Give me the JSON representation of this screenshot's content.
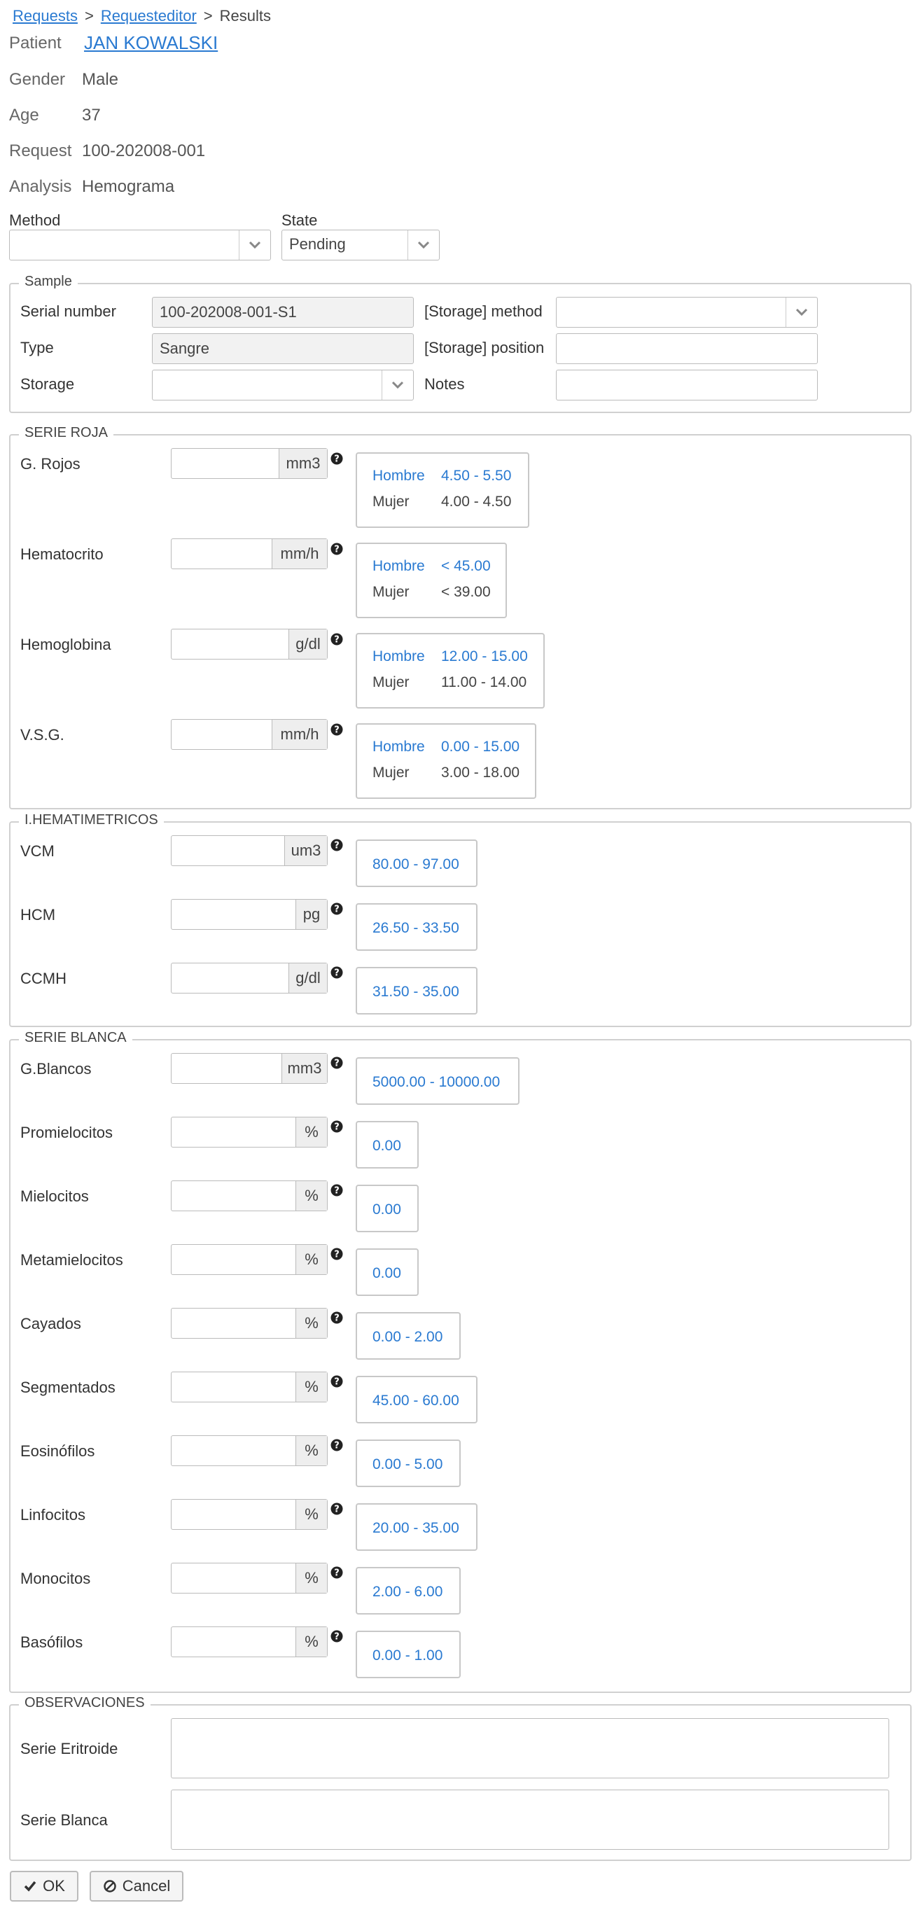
{
  "breadcrumb": {
    "link1": "Requests",
    "sep1": ">",
    "link2": "Requesteditor",
    "sep2": ">",
    "current": "Results"
  },
  "info": {
    "patient_label": "Patient",
    "patient_value": "JAN KOWALSKI",
    "gender_label": "Gender",
    "gender_value": "Male",
    "age_label": "Age",
    "age_value": "37",
    "request_label": "Request",
    "request_value": "100-202008-001",
    "analysis_label": "Analysis",
    "analysis_value": "Hemograma"
  },
  "method": {
    "label": "Method",
    "value": ""
  },
  "state": {
    "label": "State",
    "value": "Pending"
  },
  "sample": {
    "legend": "Sample",
    "serial_label": "Serial number",
    "serial_value": "100-202008-001-S1",
    "type_label": "Type",
    "type_value": "Sangre",
    "storage_label": "Storage",
    "storage_value": "",
    "storage_method_label": "[Storage] method",
    "storage_method_value": "",
    "storage_position_label": "[Storage] position",
    "storage_position_value": "",
    "notes_label": "Notes",
    "notes_value": ""
  },
  "serie_roja": {
    "legend": "SERIE ROJA",
    "items": [
      {
        "label": "G. Rojos",
        "unit": "mm3",
        "value": "",
        "hombre_label": "Hombre",
        "hombre": "4.50 - 5.50",
        "mujer_label": "Mujer",
        "mujer": "4.00 - 4.50"
      },
      {
        "label": "Hematocrito",
        "unit": "mm/h",
        "value": "",
        "hombre_label": "Hombre",
        "hombre": "< 45.00",
        "mujer_label": "Mujer",
        "mujer": "< 39.00"
      },
      {
        "label": "Hemoglobina",
        "unit": "g/dl",
        "value": "",
        "hombre_label": "Hombre",
        "hombre": "12.00 - 15.00",
        "mujer_label": "Mujer",
        "mujer": "11.00 - 14.00"
      },
      {
        "label": "V.S.G.",
        "unit": "mm/h",
        "value": "",
        "hombre_label": "Hombre",
        "hombre": "0.00 - 15.00",
        "mujer_label": "Mujer",
        "mujer": "3.00 - 18.00"
      }
    ]
  },
  "hematimetricos": {
    "legend": "I.HEMATIMETRICOS",
    "items": [
      {
        "label": "VCM",
        "unit": "um3",
        "value": "",
        "range": "80.00 - 97.00"
      },
      {
        "label": "HCM",
        "unit": "pg",
        "value": "",
        "range": "26.50 - 33.50"
      },
      {
        "label": "CCMH",
        "unit": "g/dl",
        "value": "",
        "range": "31.50 - 35.00"
      }
    ]
  },
  "serie_blanca": {
    "legend": "SERIE BLANCA",
    "items": [
      {
        "label": "G.Blancos",
        "unit": "mm3",
        "value": "",
        "range": "5000.00 - 10000.00"
      },
      {
        "label": "Promielocitos",
        "unit": "%",
        "value": "",
        "range": "0.00"
      },
      {
        "label": "Mielocitos",
        "unit": "%",
        "value": "",
        "range": "0.00"
      },
      {
        "label": "Metamielocitos",
        "unit": "%",
        "value": "",
        "range": "0.00"
      },
      {
        "label": "Cayados",
        "unit": "%",
        "value": "",
        "range": "0.00 - 2.00"
      },
      {
        "label": "Segmentados",
        "unit": "%",
        "value": "",
        "range": "45.00 - 60.00"
      },
      {
        "label": "Eosinófilos",
        "unit": "%",
        "value": "",
        "range": "0.00 - 5.00"
      },
      {
        "label": "Linfocitos",
        "unit": "%",
        "value": "",
        "range": "20.00 - 35.00"
      },
      {
        "label": "Monocitos",
        "unit": "%",
        "value": "",
        "range": "2.00 - 6.00"
      },
      {
        "label": "Basófilos",
        "unit": "%",
        "value": "",
        "range": "0.00 - 1.00"
      }
    ]
  },
  "observaciones": {
    "legend": "OBSERVACIONES",
    "eritroide_label": "Serie Eritroide",
    "eritroide_value": "",
    "blanca_label": "Serie Blanca",
    "blanca_value": ""
  },
  "buttons": {
    "ok": "OK",
    "cancel": "Cancel"
  },
  "colors": {
    "link": "#2a7ad1",
    "border": "#d0d0d0"
  }
}
